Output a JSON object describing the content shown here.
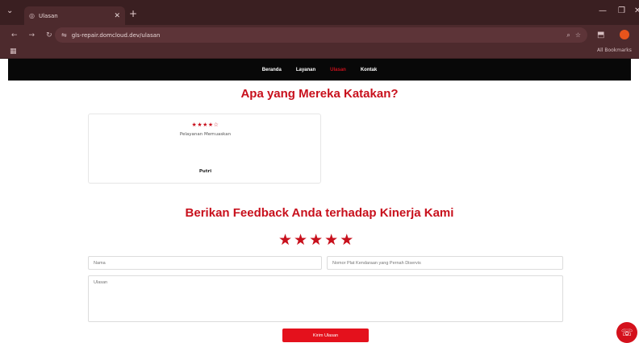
{
  "browser": {
    "tab_title": "Ulasan",
    "tab_close": "✕",
    "new_tab": "+",
    "url": "gls-repair.domcloud.dev/ulasan",
    "all_bookmarks": "All Bookmarks"
  },
  "nav": {
    "items": [
      {
        "label": "Beranda"
      },
      {
        "label": "Layanan"
      },
      {
        "label": "Ulasan"
      },
      {
        "label": "Kontak"
      }
    ],
    "accent": "#c8101c"
  },
  "reviews": {
    "heading": "Apa yang Mereka Katakan?",
    "card": {
      "stars": "★★★★☆",
      "rating": 4,
      "text": "Pelayanan Memuaskan",
      "author": "Putri"
    }
  },
  "feedback": {
    "heading": "Berikan Feedback Anda terhadap Kinerja Kami",
    "stars": [
      "★",
      "★",
      "★",
      "★",
      "★"
    ],
    "name_placeholder": "Nama",
    "plate_placeholder": "Nomor Plat Kendaraan yang Pernah Diservis",
    "review_placeholder": "Ulasan",
    "submit_label": "Kirim Ulasan"
  }
}
